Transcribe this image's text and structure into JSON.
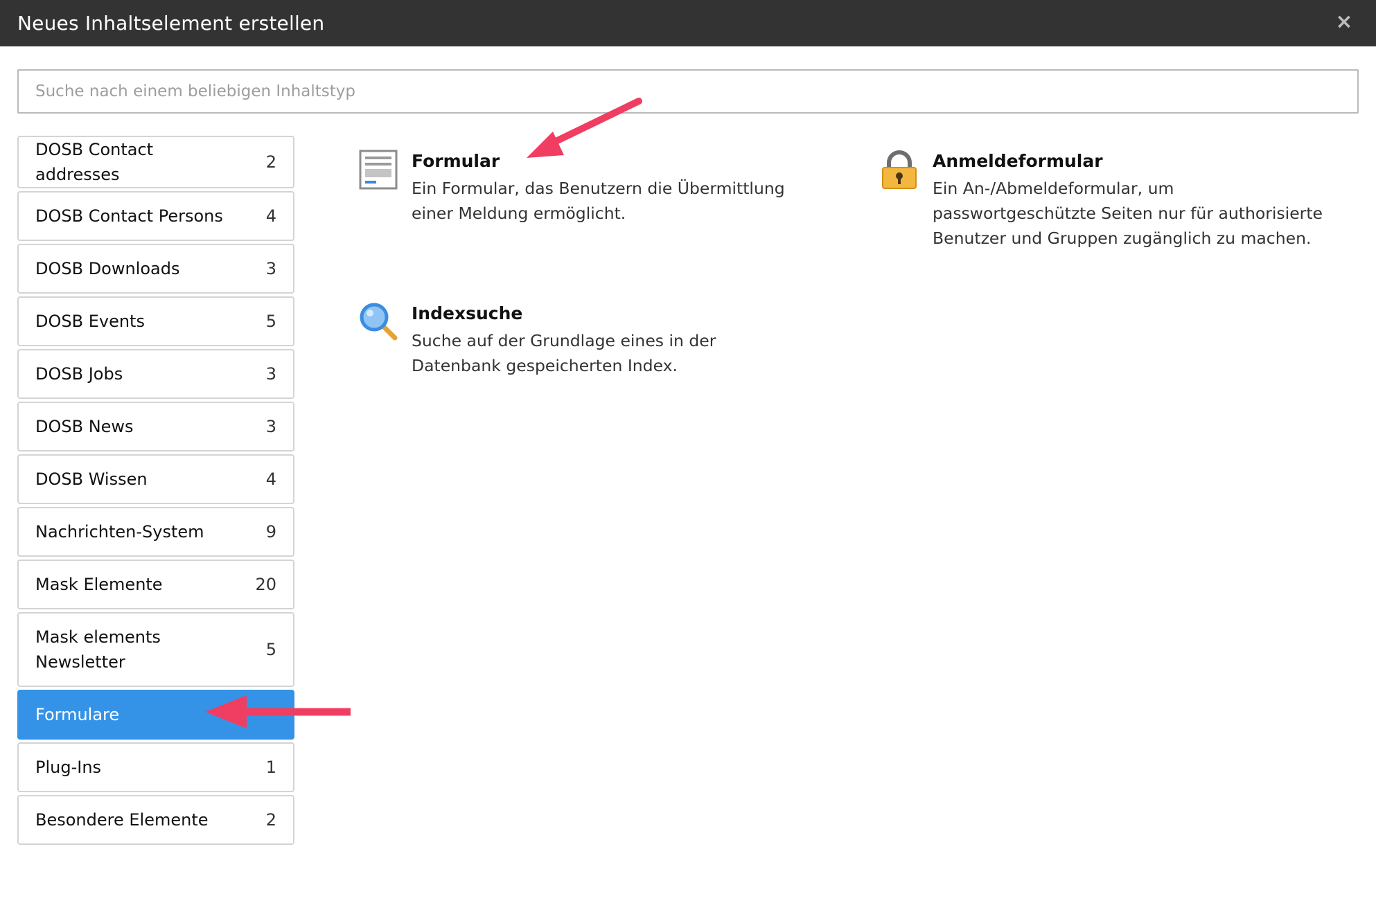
{
  "dialog": {
    "title": "Neues Inhaltselement erstellen",
    "close_symbol": "×"
  },
  "search": {
    "placeholder": "Suche nach einem beliebigen Inhaltstyp",
    "value": ""
  },
  "categories": [
    {
      "label": "DOSB Contact addresses",
      "count": "2"
    },
    {
      "label": "DOSB Contact Persons",
      "count": "4"
    },
    {
      "label": "DOSB Downloads",
      "count": "3"
    },
    {
      "label": "DOSB Events",
      "count": "5"
    },
    {
      "label": "DOSB Jobs",
      "count": "3"
    },
    {
      "label": "DOSB News",
      "count": "3"
    },
    {
      "label": "DOSB Wissen",
      "count": "4"
    },
    {
      "label": "Nachrichten-System",
      "count": "9"
    },
    {
      "label": "Mask Elemente",
      "count": "20"
    },
    {
      "label": "Mask elements Newsletter",
      "count": "5"
    },
    {
      "label": "Formulare",
      "count": "",
      "active": true
    },
    {
      "label": "Plug-Ins",
      "count": "1"
    },
    {
      "label": "Besondere Elemente",
      "count": "2"
    }
  ],
  "elements": [
    {
      "title": "Formular",
      "description_lines": [
        "Ein Formular, das Benutzern die Übermittlung",
        "einer Meldung ermöglicht."
      ],
      "icon": "form-icon"
    },
    {
      "title": "Anmeldeformular",
      "description_lines": [
        "Ein An-/Abmeldeformular, um",
        "passwortgeschützte Seiten nur für authorisierte",
        "Benutzer und Gruppen zugänglich zu machen."
      ],
      "icon": "padlock-icon"
    },
    {
      "title": "Indexsuche",
      "description_lines": [
        "Suche auf der Grundlage eines in der",
        "Datenbank gespeicherten Index."
      ],
      "icon": "magnifier-icon"
    }
  ],
  "colors": {
    "titlebar": "#333333",
    "active": "#3493e6",
    "annotation_arrow": "#f03e62"
  }
}
